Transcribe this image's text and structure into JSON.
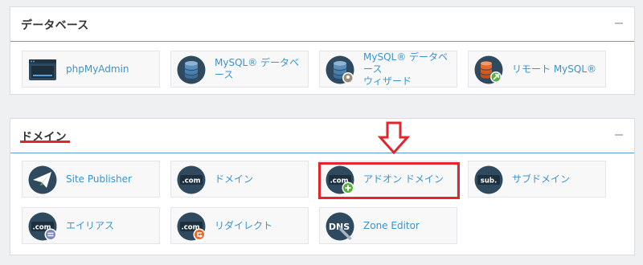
{
  "database_section": {
    "title": "データベース",
    "items": [
      {
        "label": "phpMyAdmin",
        "icon": "phpmyadmin-icon"
      },
      {
        "label": "MySQL® データベース",
        "icon": "database-icon"
      },
      {
        "label": "MySQL® データベース\nウィザード",
        "icon": "database-wizard-icon"
      },
      {
        "label": "リモート MySQL®",
        "icon": "remote-database-icon"
      }
    ]
  },
  "domain_section": {
    "title": "ドメイン",
    "items": [
      {
        "label": "Site Publisher",
        "icon": "site-publisher-icon"
      },
      {
        "label": "ドメイン",
        "icon": "domain-icon"
      },
      {
        "label": "アドオン ドメイン",
        "icon": "addon-domain-icon"
      },
      {
        "label": "サブドメイン",
        "icon": "subdomain-icon"
      },
      {
        "label": "エイリアス",
        "icon": "alias-icon"
      },
      {
        "label": "リダイレクト",
        "icon": "redirect-icon"
      },
      {
        "label": "Zone Editor",
        "icon": "zone-editor-icon"
      }
    ]
  },
  "icon_text": {
    "com": ".com",
    "sub": "sub.",
    "dns": "DNS"
  },
  "colors": {
    "link": "#3a93cf",
    "icon_dark": "#2f4a5e",
    "highlight": "#e3262b",
    "accent_green": "#5aae3d",
    "accent_orange": "#e8672a"
  }
}
